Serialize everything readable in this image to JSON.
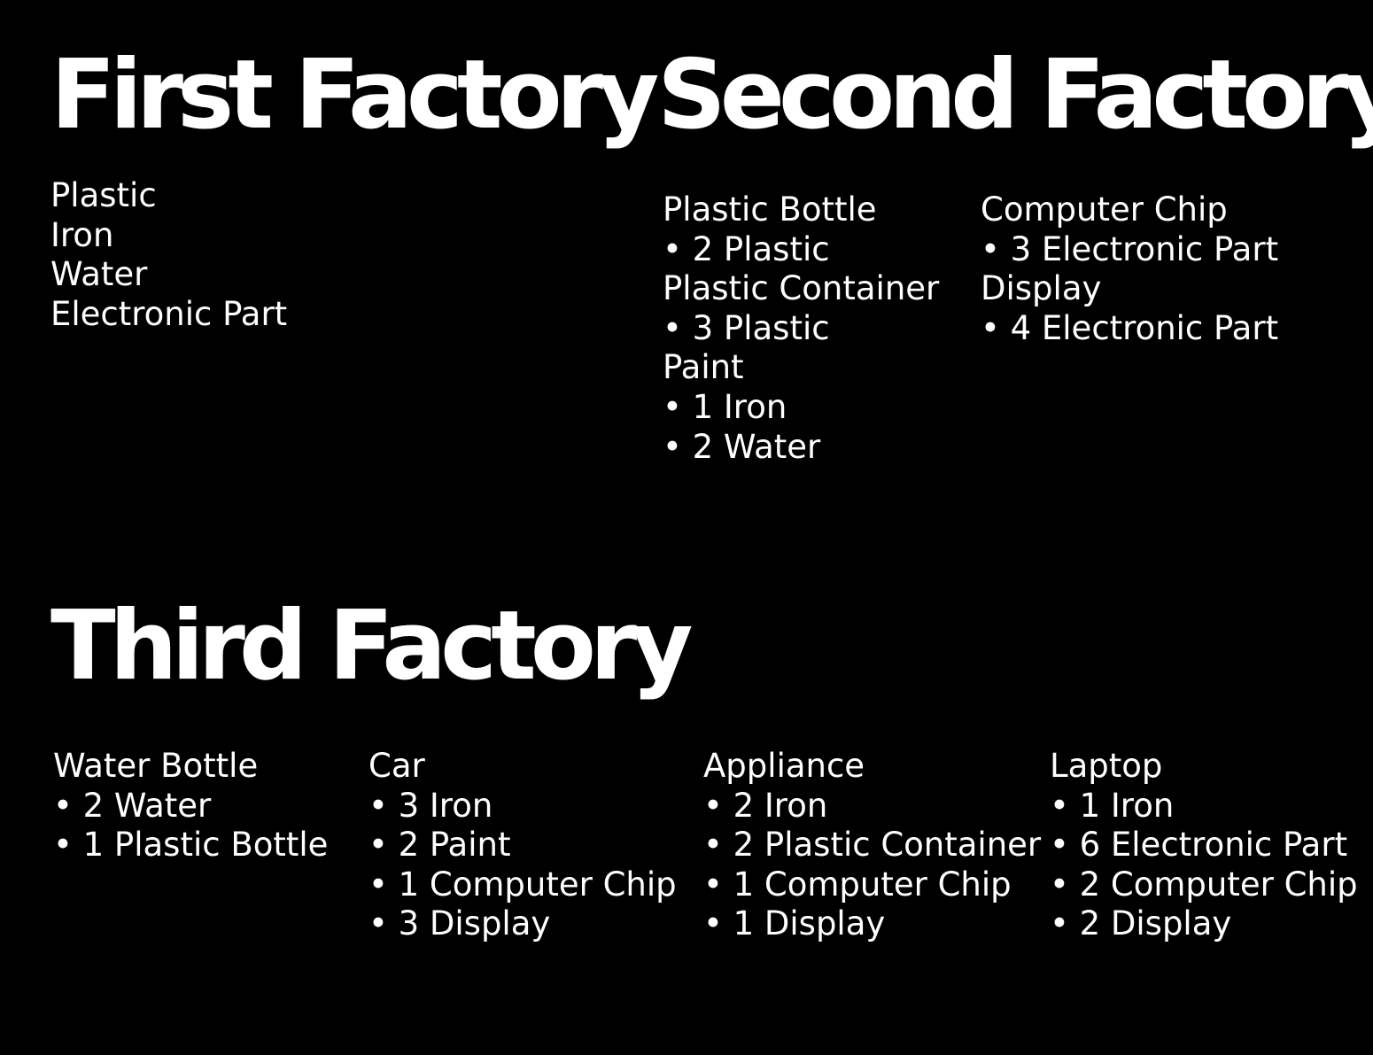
{
  "first_factory": {
    "title": "First Factory",
    "items": [
      "Plastic",
      "Iron",
      "Water",
      "Electronic Part"
    ]
  },
  "second_factory": {
    "title": "Second Factory",
    "recipes": [
      {
        "name": "Plastic Bottle",
        "ingredients": [
          "2 Plastic"
        ]
      },
      {
        "name": "Plastic Container",
        "ingredients": [
          "3 Plastic"
        ]
      },
      {
        "name": "Paint",
        "ingredients": [
          "1 Iron",
          "2 Water"
        ]
      },
      {
        "name": "Computer Chip",
        "ingredients": [
          "3 Electronic Part"
        ]
      },
      {
        "name": "Display",
        "ingredients": [
          "4 Electronic Part"
        ]
      }
    ]
  },
  "third_factory": {
    "title": "Third Factory",
    "recipes": [
      {
        "name": "Water Bottle",
        "ingredients": [
          "2 Water",
          "1 Plastic Bottle"
        ]
      },
      {
        "name": "Car",
        "ingredients": [
          "3 Iron",
          "2 Paint",
          "1 Computer Chip",
          "3 Display"
        ]
      },
      {
        "name": "Appliance",
        "ingredients": [
          "2 Iron",
          "2 Plastic Container",
          "1 Computer Chip",
          "1 Display"
        ]
      },
      {
        "name": "Laptop",
        "ingredients": [
          "1 Iron",
          "6 Electronic Part",
          "2 Computer Chip",
          "2 Display"
        ]
      }
    ]
  }
}
